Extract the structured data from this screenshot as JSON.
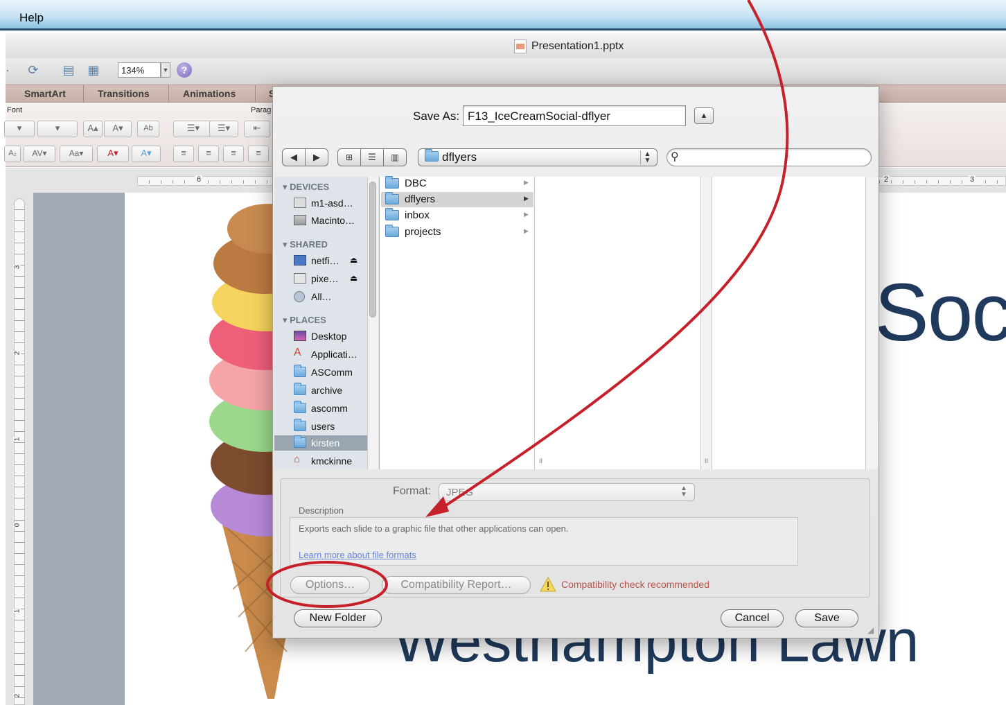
{
  "menu": {
    "help": "Help"
  },
  "window": {
    "title": "Presentation1.pptx"
  },
  "toolbar": {
    "zoom": "134%"
  },
  "ribbon": {
    "tabs": [
      "SmartArt",
      "Transitions",
      "Animations",
      "S"
    ],
    "groups": {
      "font": "Font",
      "paragraph": "Parag"
    },
    "font_size_up": "A",
    "font_size_down": "A",
    "spell_label": "Ab",
    "char_spacing": "AV",
    "change_case": "Aa",
    "font_color": "A",
    "text_effects": "A"
  },
  "ruler": {
    "h_left": "6",
    "h_right_a": "2",
    "h_right_b": "3",
    "v_labels": [
      "3",
      "2",
      "1",
      "0",
      "1",
      "2"
    ]
  },
  "slide": {
    "title_fragment": "Soc",
    "subtitle": "Westhampton Lawn"
  },
  "dialog": {
    "save_as_label": "Save As:",
    "save_as_value": "F13_IceCreamSocial-dflyer",
    "current_folder": "dflyers",
    "search_placeholder": "",
    "sidebar": {
      "devices_header": "DEVICES",
      "shared_header": "SHARED",
      "places_header": "PLACES",
      "devices": [
        "m1-asd…",
        "Macinto…"
      ],
      "shared": [
        "netfi…",
        "pixe…",
        "All…"
      ],
      "places": [
        "Desktop",
        "Applicati…",
        "ASComm",
        "archive",
        "ascomm",
        "users",
        "kirsten",
        "kmckinne"
      ]
    },
    "column1": [
      "DBC",
      "dflyers",
      "inbox",
      "projects"
    ],
    "format_label": "Format:",
    "format_value": "JPEG",
    "description_label": "Description",
    "description_text": "Exports each slide to a graphic file that other applications can open.",
    "learn_more": "Learn more about file formats",
    "options_button": "Options…",
    "compat_button": "Compatibility Report…",
    "compat_note": "Compatibility check recommended",
    "new_folder_button": "New Folder",
    "cancel_button": "Cancel",
    "save_button": "Save"
  },
  "colors": {
    "annotation": "#c8202a",
    "selection": "#9aa5b2",
    "slide_text": "#1f3a5c"
  }
}
